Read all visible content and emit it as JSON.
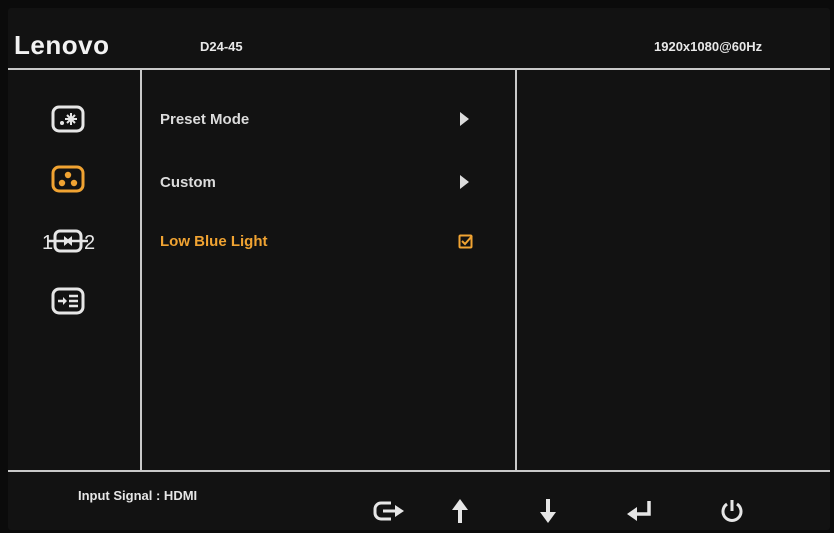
{
  "header": {
    "brand": "Lenovo",
    "model": "D24-45",
    "resolution": "1920x1080@60Hz"
  },
  "sidebar": {
    "items": [
      {
        "icon": "brightness-contrast-icon",
        "active": false
      },
      {
        "icon": "color-icon",
        "active": true
      },
      {
        "icon": "input-source-icon",
        "active": false
      },
      {
        "icon": "menu-settings-icon",
        "active": false
      }
    ]
  },
  "menu": {
    "items": [
      {
        "label": "Preset Mode",
        "control": "arrow",
        "active": false
      },
      {
        "label": "Custom",
        "control": "arrow",
        "active": false
      },
      {
        "label": "Low Blue Light",
        "control": "checkbox",
        "checked": true,
        "active": true
      }
    ]
  },
  "footer": {
    "input_signal": "Input Signal : HDMI",
    "buttons": [
      "input-switch-icon",
      "up-arrow-icon",
      "down-arrow-icon",
      "enter-icon",
      "power-icon"
    ]
  },
  "colors": {
    "accent": "#f0a332",
    "text": "#dcdcdc",
    "background": "#121212",
    "divider": "#c9c9c9"
  }
}
